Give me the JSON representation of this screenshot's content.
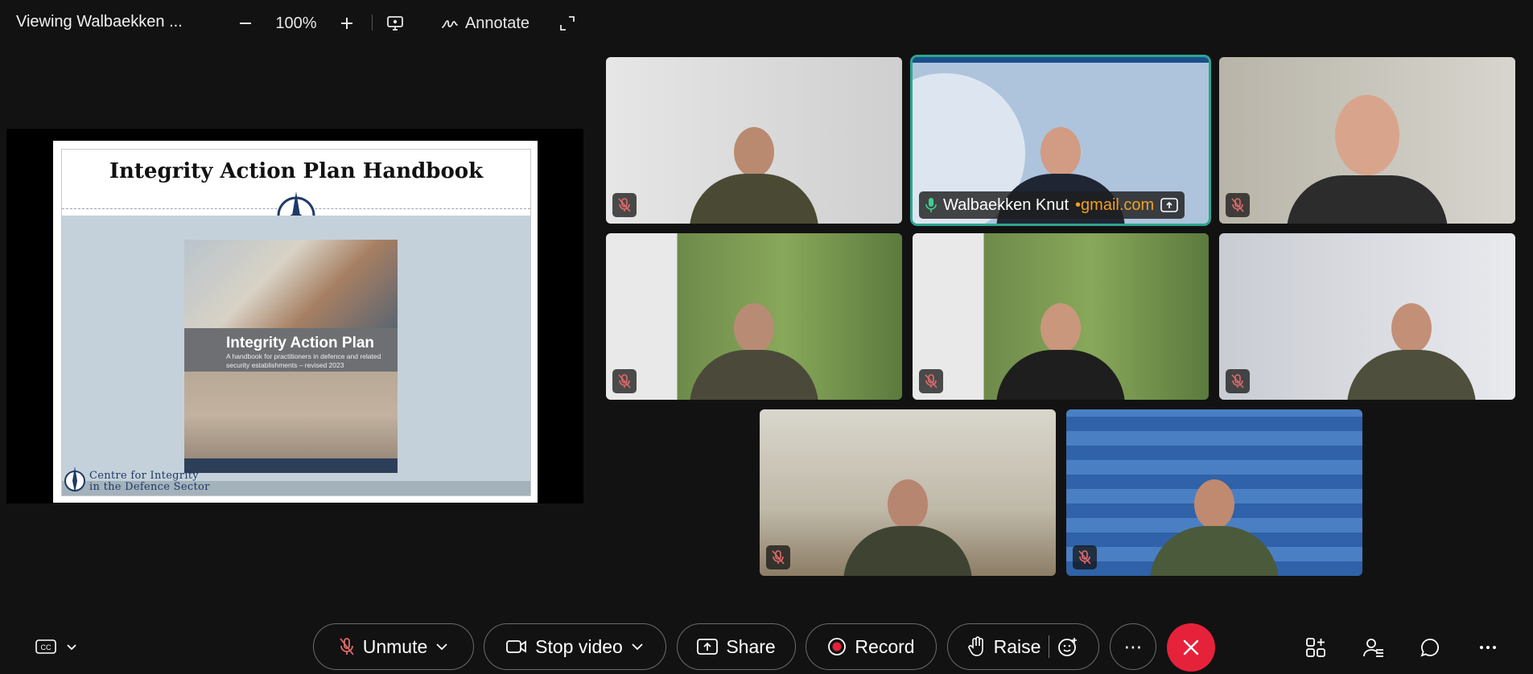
{
  "topbar": {
    "title": "Viewing Walbaekken ...",
    "zoom_out_icon": "minus-icon",
    "zoom_level": "100%",
    "zoom_in_icon": "plus-icon",
    "annotate_label": "Annotate"
  },
  "shared_slide": {
    "title": "Integrity Action Plan Handbook",
    "book_title": "Integrity Action Plan",
    "book_subtitle": "A handbook for practitioners in defence and related security establishments – revised 2023",
    "footer_line1": "Centre for Integrity",
    "footer_line2": "in the Defence Sector"
  },
  "participants": [
    {
      "id": "p1",
      "muted": true
    },
    {
      "id": "p2",
      "name": "Walbaekken Knut",
      "email": "gmail.com",
      "sep": "•",
      "speaking": true,
      "sharing": true
    },
    {
      "id": "p3",
      "muted": true
    },
    {
      "id": "p4",
      "muted": true
    },
    {
      "id": "p5",
      "muted": true
    },
    {
      "id": "p6",
      "muted": true
    },
    {
      "id": "p7",
      "muted": true
    },
    {
      "id": "p8",
      "muted": true
    }
  ],
  "controls": {
    "unmute": "Unmute",
    "stop_video": "Stop video",
    "share": "Share",
    "record": "Record",
    "raise": "Raise",
    "more": "⋯"
  },
  "right_tools": [
    "apps-icon",
    "participants-icon",
    "chat-icon",
    "more-options-icon"
  ],
  "colors": {
    "background": "#121212",
    "active_speaker_border": "#2fa58f",
    "leave_button": "#e6223b",
    "email_accent": "#f0a020",
    "mute_icon": "#e06a6a"
  }
}
